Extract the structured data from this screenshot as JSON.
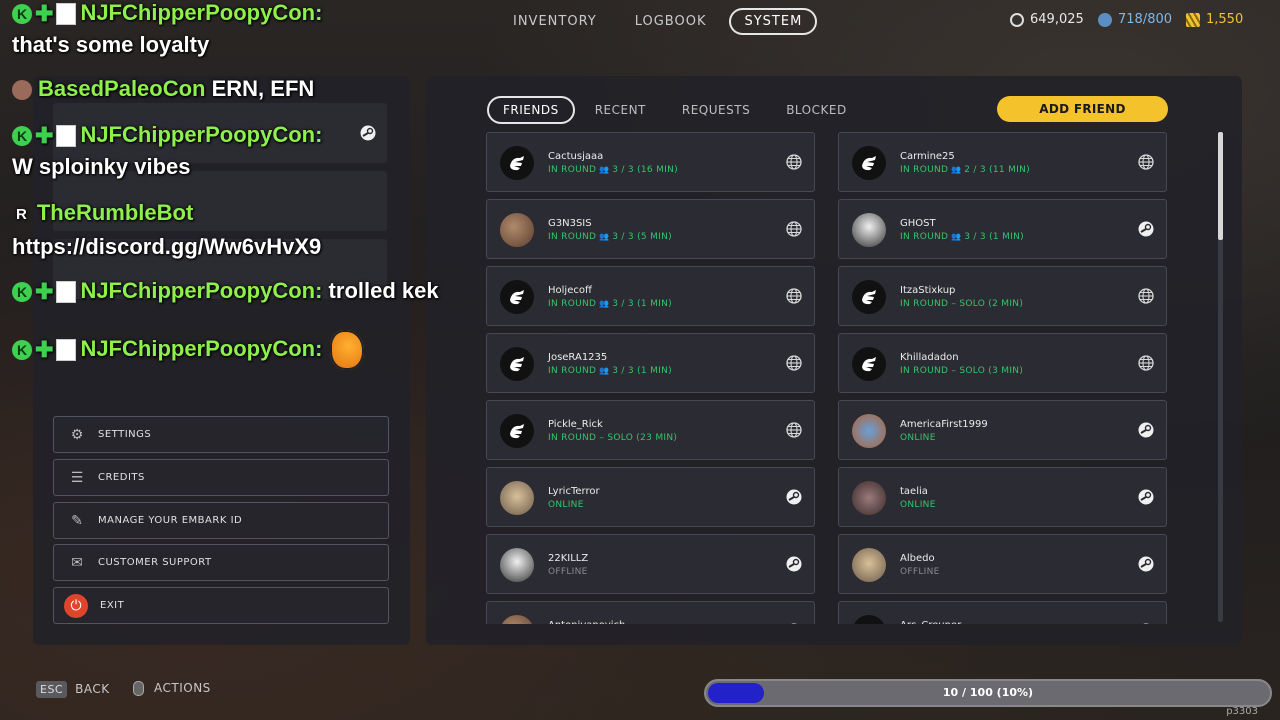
{
  "top_nav": {
    "tabs": [
      "INVENTORY",
      "LOGBOOK",
      "SYSTEM"
    ],
    "active": "SYSTEM"
  },
  "currencies": [
    {
      "icon": "coin-icon",
      "value": "649,025",
      "color": "#e8e8e8"
    },
    {
      "icon": "token-icon",
      "value": "718/800",
      "color": "#7fb6e8"
    },
    {
      "icon": "multibucks-icon",
      "value": "1,550",
      "color": "#f1c232"
    }
  ],
  "system_menu": [
    {
      "icon": "gear-icon",
      "label": "SETTINGS"
    },
    {
      "icon": "credits-icon",
      "label": "CREDITS"
    },
    {
      "icon": "embark-id-icon",
      "label": "MANAGE YOUR EMBARK ID"
    },
    {
      "icon": "chat-support-icon",
      "label": "CUSTOMER SUPPORT"
    },
    {
      "icon": "power-icon",
      "label": "EXIT"
    }
  ],
  "friends_tabs": [
    "FRIENDS",
    "RECENT",
    "REQUESTS",
    "BLOCKED"
  ],
  "active_friends_tab": "FRIENDS",
  "add_friend_label": "ADD FRIEND",
  "friends": [
    {
      "name": "Cactusjaaa",
      "status": "IN ROUND",
      "party": "3 / 3 (16 MIN)",
      "platform": "globe",
      "avatar": "embark",
      "state": "online"
    },
    {
      "name": "Carmine25",
      "status": "IN ROUND",
      "party": "2 / 3 (11 MIN)",
      "platform": "globe",
      "avatar": "embark",
      "state": "online"
    },
    {
      "name": "G3N3SIS",
      "status": "IN ROUND",
      "party": "3 / 3 (5 MIN)",
      "platform": "globe",
      "avatar": "photo",
      "state": "online"
    },
    {
      "name": "GHOST",
      "status": "IN ROUND",
      "party": "3 / 3 (1 MIN)",
      "platform": "steam",
      "avatar": "photo3",
      "state": "online"
    },
    {
      "name": "Holjecoff",
      "status": "IN ROUND",
      "party": "3 / 3 (1 MIN)",
      "platform": "globe",
      "avatar": "embark",
      "state": "online"
    },
    {
      "name": "ItzaStixkup",
      "status": "IN ROUND – SOLO (2 MIN)",
      "party": "",
      "platform": "globe",
      "avatar": "embark",
      "state": "online"
    },
    {
      "name": "JoseRA1235",
      "status": "IN ROUND",
      "party": "3 / 3 (1 MIN)",
      "platform": "globe",
      "avatar": "embark",
      "state": "online"
    },
    {
      "name": "Khilladadon",
      "status": "IN ROUND – SOLO (3 MIN)",
      "party": "",
      "platform": "globe",
      "avatar": "embark",
      "state": "online"
    },
    {
      "name": "Pickle_Rick",
      "status": "IN ROUND – SOLO (23 MIN)",
      "party": "",
      "platform": "globe",
      "avatar": "embark",
      "state": "online"
    },
    {
      "name": "AmericaFirst1999",
      "status": "ONLINE",
      "party": "",
      "platform": "steam",
      "avatar": "photo4",
      "state": "online"
    },
    {
      "name": "LyricTerror",
      "status": "ONLINE",
      "party": "",
      "platform": "steam",
      "avatar": "photo2",
      "state": "online"
    },
    {
      "name": "taelia",
      "status": "ONLINE",
      "party": "",
      "platform": "steam",
      "avatar": "photo5",
      "state": "online"
    },
    {
      "name": "22KILLZ",
      "status": "OFFLINE",
      "party": "",
      "platform": "steam",
      "avatar": "photo3",
      "state": "offline"
    },
    {
      "name": "Albedo",
      "status": "OFFLINE",
      "party": "",
      "platform": "steam",
      "avatar": "photo2",
      "state": "offline"
    },
    {
      "name": "Antonivanovich",
      "status": "",
      "party": "",
      "platform": "steam",
      "avatar": "photo",
      "state": "offline"
    },
    {
      "name": "Arc_Creuner",
      "status": "",
      "party": "",
      "platform": "steam",
      "avatar": "embark",
      "state": "offline"
    }
  ],
  "chat": [
    {
      "user": "NJFChipperPoopyCon:",
      "message": "",
      "badges": true
    },
    {
      "user": "",
      "message": "that's some loyalty",
      "badges": false
    },
    {
      "user": "BasedPaleoCon",
      "message": "ERN, EFN",
      "badges": false,
      "avatar": true
    },
    {
      "user": "NJFChipperPoopyCon:",
      "message": "",
      "badges": true
    },
    {
      "user": "",
      "message": "W sploinky vibes",
      "badges": false
    },
    {
      "user": "TheRumbleBot",
      "message": "",
      "badges": false,
      "bot": true
    },
    {
      "user": "",
      "message": "https://discord.gg/Ww6vHvX9",
      "badges": false
    },
    {
      "user": "NJFChipperPoopyCon:",
      "message": "trolled kek",
      "badges": true
    },
    {
      "user": "NJFChipperPoopyCon:",
      "message": "",
      "badges": true,
      "emote": true
    }
  ],
  "bottom": {
    "esc_key": "ESC",
    "back_label": "BACK",
    "actions_label": "ACTIONS"
  },
  "progress": {
    "text": "10 / 100 (10%)",
    "fraction": 0.1
  },
  "corner_tag": "p3303"
}
